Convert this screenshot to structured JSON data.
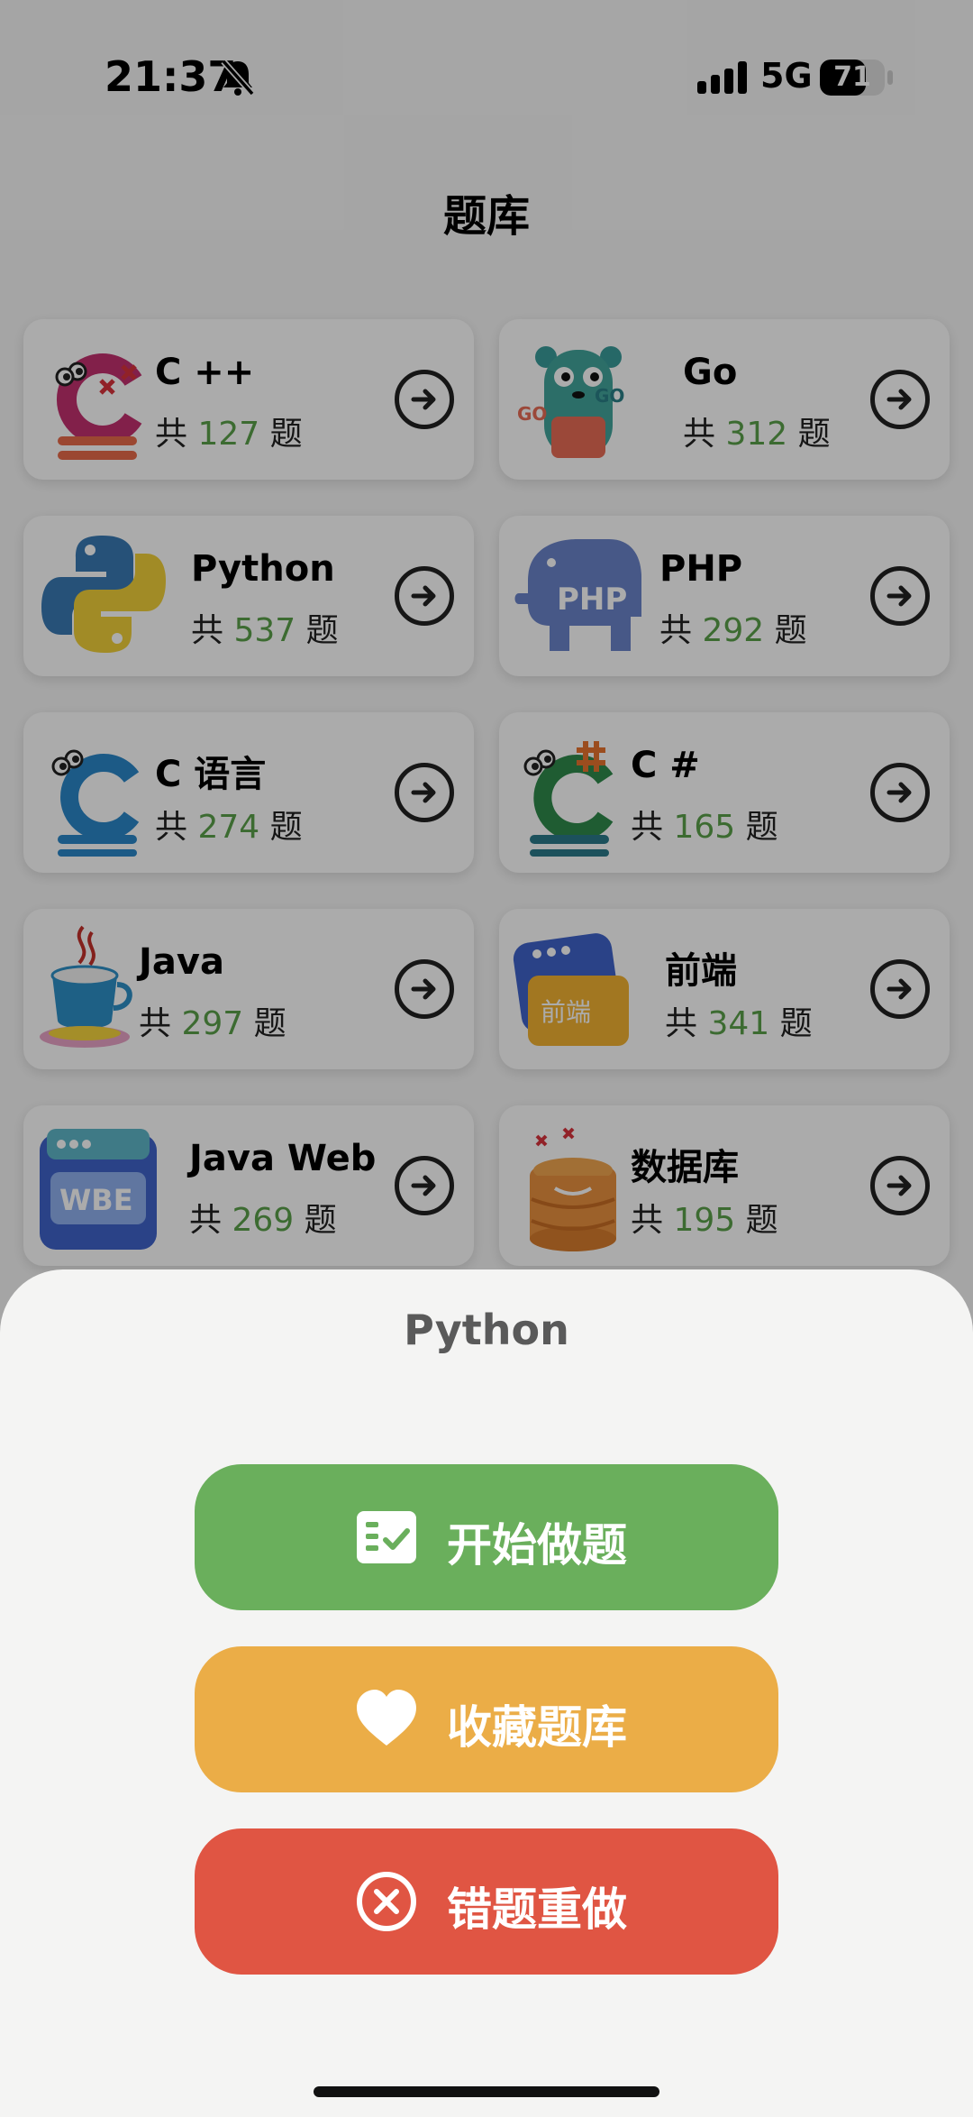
{
  "status_bar": {
    "time": "21:37",
    "network": "5G",
    "battery": "71",
    "battery_level": 0.71
  },
  "page": {
    "title": "题库"
  },
  "count_prefix": "共",
  "count_suffix": "题",
  "banks": [
    {
      "name": "C ++",
      "count": "127",
      "icon": "cpp-logo"
    },
    {
      "name": "Go",
      "count": "312",
      "icon": "go-gopher-logo"
    },
    {
      "name": "Python",
      "count": "537",
      "icon": "python-logo"
    },
    {
      "name": "PHP",
      "count": "292",
      "icon": "php-elephant-logo"
    },
    {
      "name": "C 语言",
      "count": "274",
      "icon": "c-language-logo"
    },
    {
      "name": "C #",
      "count": "165",
      "icon": "csharp-logo"
    },
    {
      "name": "Java",
      "count": "297",
      "icon": "java-coffee-logo"
    },
    {
      "name": "前端",
      "count": "341",
      "icon": "frontend-window-logo"
    },
    {
      "name": "Java Web",
      "count": "269",
      "icon": "java-web-logo"
    },
    {
      "name": "数据库",
      "count": "195",
      "icon": "database-logo"
    }
  ],
  "logo_text": {
    "go": "GO",
    "php": "PHP",
    "frontend": "前端",
    "javaweb": "WBE"
  },
  "sheet": {
    "title": "Python",
    "actions": [
      {
        "label": "开始做题",
        "icon": "checklist-icon",
        "color": "#6aaf5c"
      },
      {
        "label": "收藏题库",
        "icon": "heart-icon",
        "color": "#ebad47"
      },
      {
        "label": "错题重做",
        "icon": "circle-x-icon",
        "color": "#e05543"
      }
    ]
  }
}
